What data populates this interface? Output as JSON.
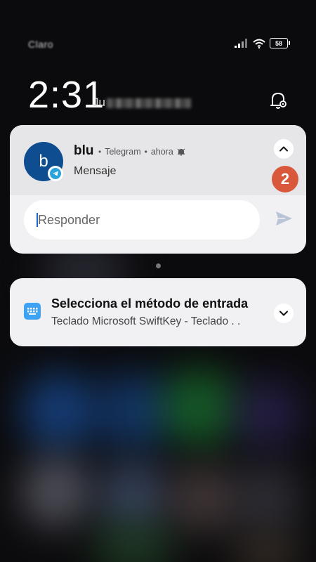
{
  "status_bar": {
    "carrier": "Claro",
    "battery_level": "58",
    "icons": [
      "signal-icon",
      "wifi-icon",
      "battery-icon"
    ]
  },
  "lock_screen": {
    "time": "2:31",
    "date_visible": "Ju",
    "focus_icon": "focus-mode-icon"
  },
  "notifications": [
    {
      "avatar_letter": "b",
      "sender": "blu",
      "app": "Telegram",
      "time": "ahora",
      "message": "Mensaje",
      "unread_count": "2",
      "reply_placeholder": "Responder",
      "icons": [
        "telegram-icon",
        "bell-icon",
        "chevron-up-icon",
        "send-icon"
      ]
    },
    {
      "title": "Selecciona el método de entrada",
      "subtitle": "Teclado Microsoft SwiftKey - Teclado . .",
      "icons": [
        "keyboard-icon",
        "chevron-down-icon"
      ]
    }
  ],
  "colors": {
    "avatar": "#0e4d8f",
    "telegram": "#2aa3dc",
    "badge": "#d9583b",
    "keyboard": "#3fa3f4"
  }
}
